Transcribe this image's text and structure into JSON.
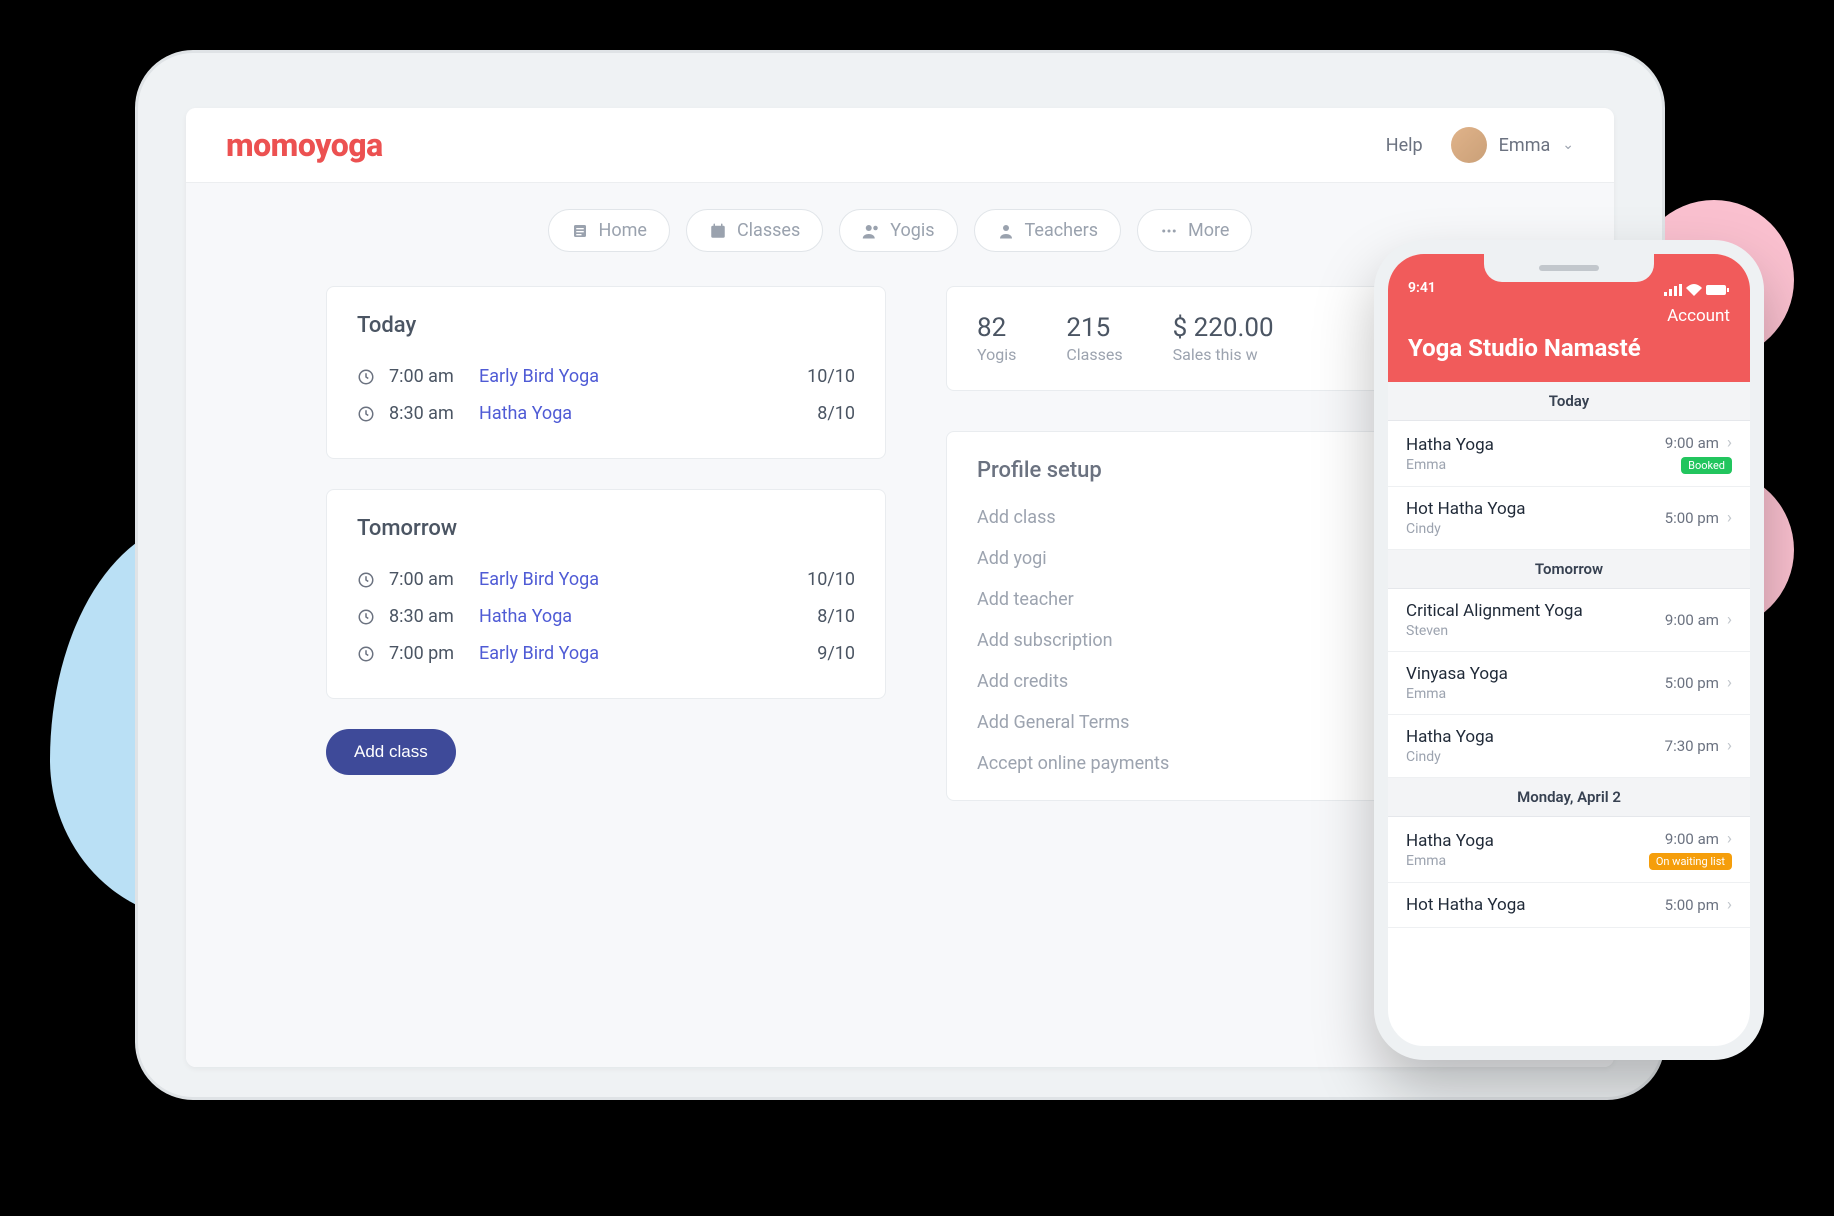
{
  "header": {
    "logo": "momoyoga",
    "help": "Help",
    "username": "Emma"
  },
  "nav": {
    "home": "Home",
    "classes": "Classes",
    "yogis": "Yogis",
    "teachers": "Teachers",
    "more": "More"
  },
  "today": {
    "title": "Today",
    "rows": [
      {
        "time": "7:00 am",
        "name": "Early Bird Yoga",
        "cap": "10/10"
      },
      {
        "time": "8:30 am",
        "name": "Hatha Yoga",
        "cap": "8/10"
      }
    ]
  },
  "tomorrow": {
    "title": "Tomorrow",
    "rows": [
      {
        "time": "7:00 am",
        "name": "Early Bird Yoga",
        "cap": "10/10"
      },
      {
        "time": "8:30 am",
        "name": "Hatha Yoga",
        "cap": "8/10"
      },
      {
        "time": "7:00 pm",
        "name": "Early Bird Yoga",
        "cap": "9/10"
      }
    ]
  },
  "add_class": "Add class",
  "stats": [
    {
      "num": "82",
      "lbl": "Yogis"
    },
    {
      "num": "215",
      "lbl": "Classes"
    },
    {
      "num": "$ 220.00",
      "lbl": "Sales this w"
    }
  ],
  "profile": {
    "title": "Profile setup",
    "items": [
      "Add class",
      "Add yogi",
      "Add teacher",
      "Add subscription",
      "Add credits",
      "Add General Terms",
      "Accept online payments"
    ]
  },
  "phone": {
    "status_time": "9:41",
    "account": "Account",
    "studio": "Yoga Studio Namasté",
    "sections": [
      {
        "header": "Today",
        "rows": [
          {
            "title": "Hatha Yoga",
            "sub": "Emma",
            "time": "9:00 am",
            "badge": "Booked",
            "badge_class": "badge-green"
          },
          {
            "title": "Hot Hatha Yoga",
            "sub": "Cindy",
            "time": "5:00 pm"
          }
        ]
      },
      {
        "header": "Tomorrow",
        "rows": [
          {
            "title": "Critical Alignment Yoga",
            "sub": "Steven",
            "time": "9:00 am"
          },
          {
            "title": "Vinyasa Yoga",
            "sub": "Emma",
            "time": "5:00 pm"
          },
          {
            "title": "Hatha Yoga",
            "sub": "Cindy",
            "time": "7:30 pm"
          }
        ]
      },
      {
        "header": "Monday, April 2",
        "rows": [
          {
            "title": "Hatha Yoga",
            "sub": "Emma",
            "time": "9:00 am",
            "badge": "On waiting list",
            "badge_class": "badge-orange"
          },
          {
            "title": "Hot Hatha Yoga",
            "sub": "",
            "time": "5:00 pm"
          }
        ]
      }
    ]
  }
}
